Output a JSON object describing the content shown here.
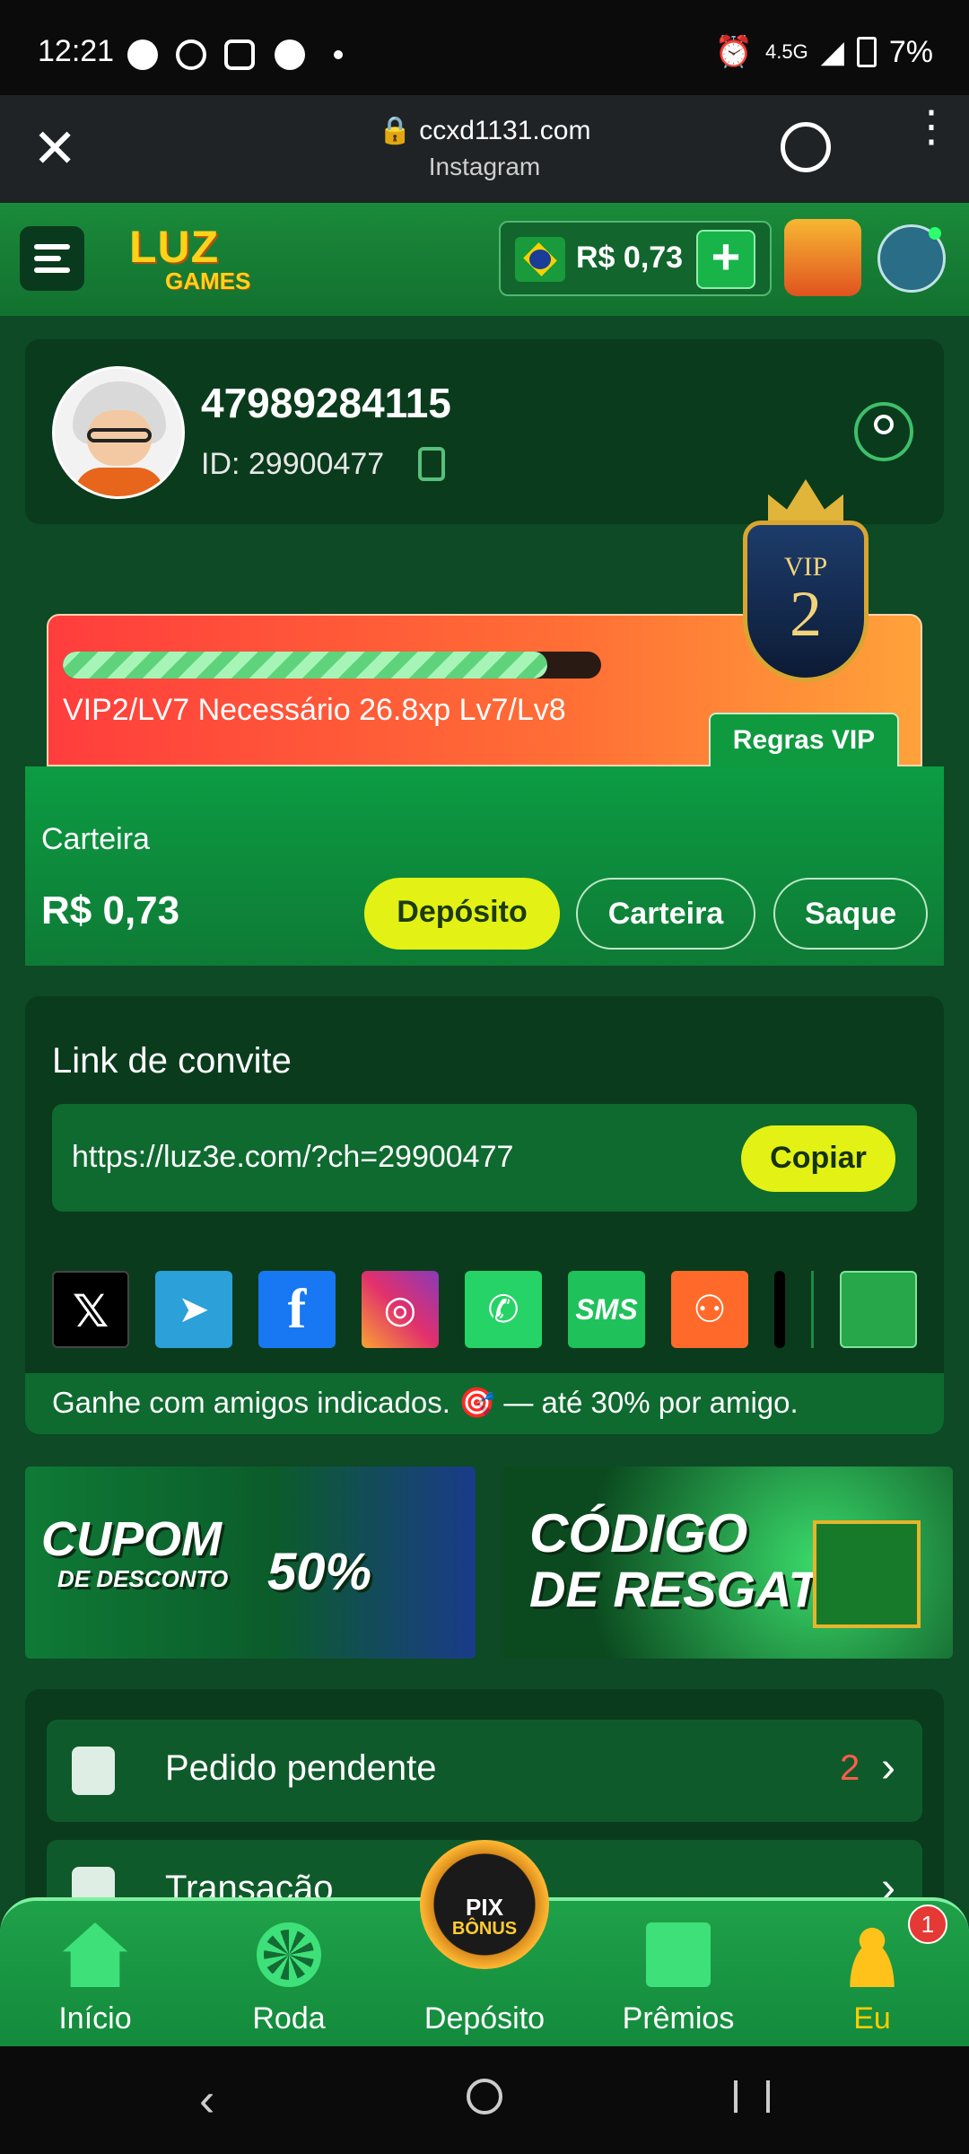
{
  "status_bar": {
    "time": "12:21",
    "network": "4.5G",
    "battery": "7%"
  },
  "browser": {
    "url": "ccxd1131.com",
    "source": "Instagram"
  },
  "header": {
    "logo_line1": "LUZ",
    "logo_line2": "GAMES",
    "balance": "R$ 0,73"
  },
  "profile": {
    "username": "47989284115",
    "user_id": "ID: 29900477"
  },
  "vip": {
    "badge_text": "VIP",
    "badge_level": "2",
    "progress_text": "VIP2/LV7 Necessário 26.8xp Lv7/Lv8",
    "progress_fraction": 0.9,
    "rules_button": "Regras VIP"
  },
  "wallet": {
    "label": "Carteira",
    "amount": "R$ 0,73",
    "deposit_button": "Depósito",
    "wallet_button": "Carteira",
    "withdraw_button": "Saque"
  },
  "invite": {
    "title": "Link de convite",
    "link": "https://luz3e.com/?ch=29900477",
    "copy_button": "Copiar",
    "tip": "Ganhe com amigos indicados. 🎯 — até 30% por amigo.",
    "social": [
      "x-icon",
      "telegram-icon",
      "facebook-icon",
      "instagram-icon",
      "whatsapp-icon",
      "sms-icon",
      "kwai-icon",
      "more-icon"
    ],
    "sms_label": "SMS"
  },
  "promos": {
    "coupon_line1": "CUPOM",
    "coupon_line2": "DE DESCONTO",
    "coupon_pct": "50%",
    "redeem_line1": "CÓDIGO",
    "redeem_line2": "DE RESGATE"
  },
  "list": {
    "pending_label": "Pedido pendente",
    "pending_count": "2",
    "transaction_label": "Transação"
  },
  "bottom_nav": {
    "home": "Início",
    "wheel": "Roda",
    "deposit": "Depósito",
    "prizes": "Prêmios",
    "me": "Eu",
    "pix_line1": "PIX",
    "pix_line2": "BÔNUS",
    "notification_count": "1"
  },
  "colors": {
    "accent_green": "#0c9c43",
    "button_yellow": "#e3f214",
    "vip_orange": "#ff6f35",
    "active_nav": "#ffcc00"
  }
}
